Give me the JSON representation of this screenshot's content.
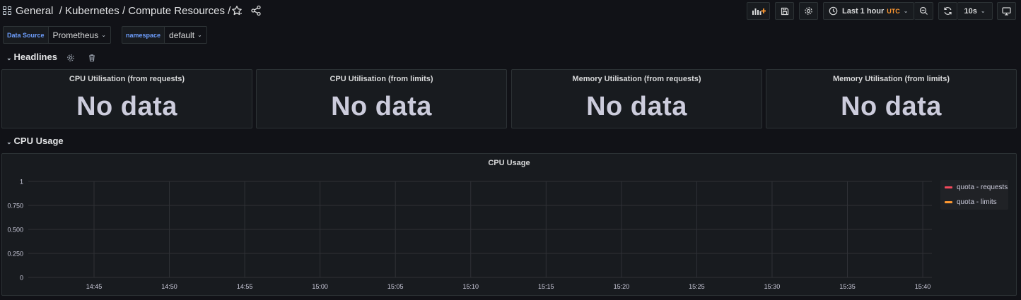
{
  "breadcrumb": {
    "folder": "General",
    "path": "/ Kubernetes / Compute Resources / ..."
  },
  "toolbar": {
    "time_range": "Last 1 hour",
    "timezone": "UTC",
    "refresh_interval": "10s"
  },
  "variables": [
    {
      "label": "Data Source",
      "value": "Prometheus"
    },
    {
      "label": "namespace",
      "value": "default"
    }
  ],
  "rows": {
    "headlines": "Headlines",
    "cpu_usage": "CPU Usage"
  },
  "stat_panels": [
    {
      "title": "CPU Utilisation (from requests)",
      "value": "No data"
    },
    {
      "title": "CPU Utilisation (from limits)",
      "value": "No data"
    },
    {
      "title": "Memory Utilisation (from requests)",
      "value": "No data"
    },
    {
      "title": "Memory Utilisation (from limits)",
      "value": "No data"
    }
  ],
  "colors": {
    "requests": "#f2495c",
    "limits": "#ff9830",
    "accent_blue": "#6e9fff"
  },
  "chart_data": {
    "type": "line",
    "title": "CPU Usage",
    "x": [
      "14:45",
      "14:50",
      "14:55",
      "15:00",
      "15:05",
      "15:10",
      "15:15",
      "15:20",
      "15:25",
      "15:30",
      "15:35",
      "15:40"
    ],
    "y_ticks": [
      "0",
      "0.250",
      "0.500",
      "0.750",
      "1"
    ],
    "ylim": [
      0,
      1
    ],
    "grid": true,
    "legend_position": "right",
    "series": [
      {
        "name": "quota - requests",
        "color": "#f2495c",
        "values": []
      },
      {
        "name": "quota - limits",
        "color": "#ff9830",
        "values": []
      }
    ]
  }
}
